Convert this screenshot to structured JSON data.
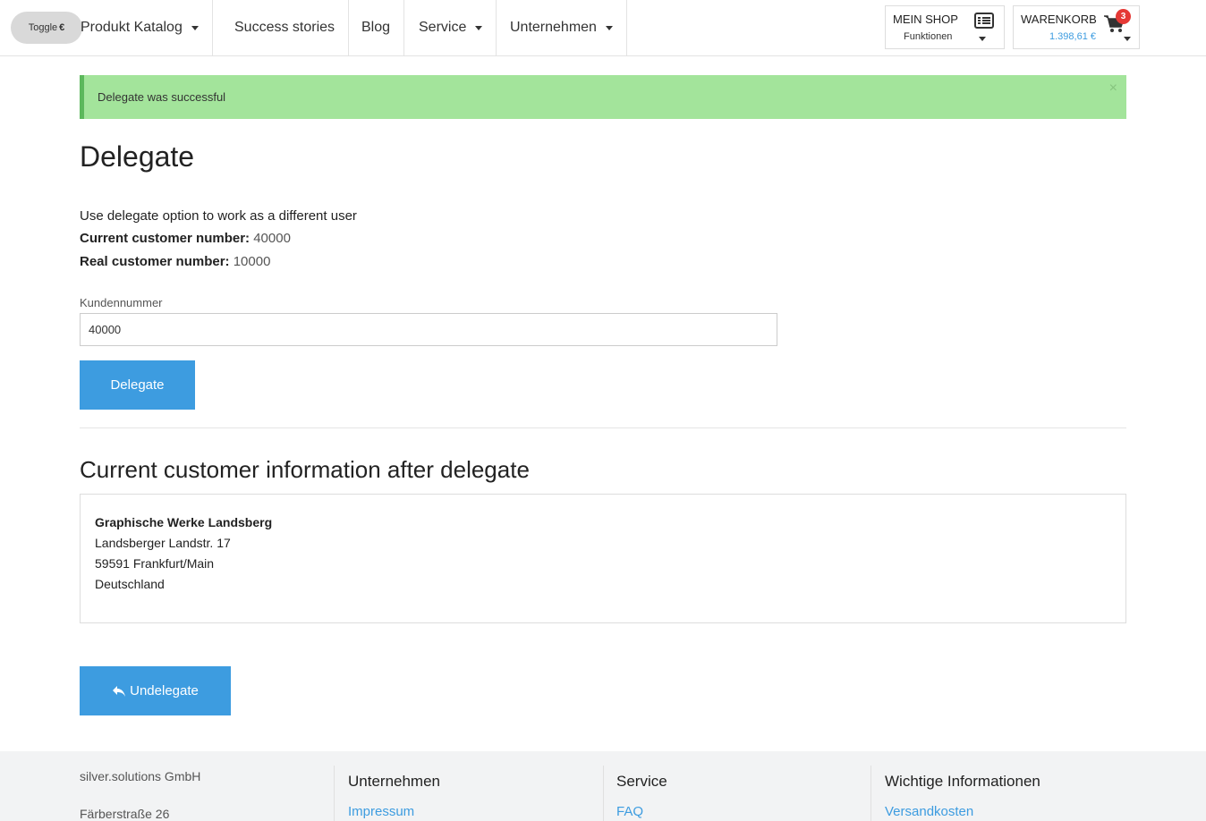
{
  "nav": {
    "toggle_label": "Toggle",
    "toggle_symbol": "€",
    "items": [
      {
        "label": "Produkt Katalog",
        "dropdown": true
      },
      {
        "label": "Success stories",
        "dropdown": false
      },
      {
        "label": "Blog",
        "dropdown": false
      },
      {
        "label": "Service",
        "dropdown": true
      },
      {
        "label": "Unternehmen",
        "dropdown": true
      }
    ],
    "myshop": {
      "title": "MEIN SHOP",
      "subtitle": "Funktionen",
      "icon": "list-icon"
    },
    "cart": {
      "title": "WARENKORB",
      "total": "1.398,61 €",
      "count": "3",
      "icon": "cart-icon"
    }
  },
  "alert": {
    "message": "Delegate was successful",
    "close": "×",
    "color": "#a3e49b"
  },
  "page": {
    "title": "Delegate",
    "description": "Use delegate option to work as a different user",
    "current_label": "Current customer number:",
    "current_value": "40000",
    "real_label": "Real customer number:",
    "real_value": "10000",
    "field_label": "Kundennummer",
    "field_value": "40000",
    "delegate_button": "Delegate",
    "info_title": "Current customer information after delegate",
    "address": {
      "name": "Graphische Werke Landsberg",
      "street": "Landsberger Landstr. 17",
      "city": "59591 Frankfurt/Main",
      "country": "Deutschland"
    },
    "undelegate_button": "Undelegate",
    "accent_color": "#3d9ce0"
  },
  "footer": {
    "company": "silver.solutions GmbH",
    "street": "Färberstraße 26",
    "columns": [
      {
        "title": "Unternehmen",
        "link": "Impressum"
      },
      {
        "title": "Service",
        "link": "FAQ"
      },
      {
        "title": "Wichtige Informationen",
        "link": "Versandkosten"
      }
    ]
  }
}
